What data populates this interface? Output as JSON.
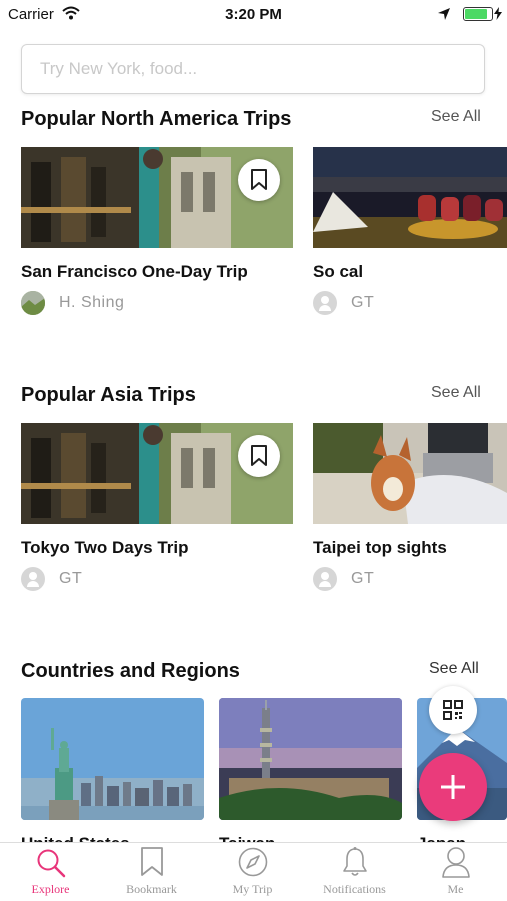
{
  "status_bar": {
    "carrier": "Carrier",
    "time": "3:20 PM"
  },
  "search": {
    "placeholder": "Try New York, food..."
  },
  "sections": {
    "north_america": {
      "title": "Popular North America Trips",
      "see_all": "See All",
      "cards": [
        {
          "title": "San Francisco One-Day Trip",
          "author": "H. Shing"
        },
        {
          "title": "So cal",
          "author": "GT"
        }
      ]
    },
    "asia": {
      "title": "Popular Asia Trips",
      "see_all": "See All",
      "cards": [
        {
          "title": "Tokyo Two Days Trip",
          "author": "GT"
        },
        {
          "title": "Taipei top sights",
          "author": "GT"
        }
      ]
    },
    "regions": {
      "title": "Countries and Regions",
      "see_all": "See All",
      "items": [
        {
          "label": "United States"
        },
        {
          "label": "Taiwan"
        },
        {
          "label": "Japan"
        }
      ]
    }
  },
  "tab_bar": {
    "tabs": [
      {
        "label": "Explore",
        "icon": "search-icon",
        "active": true
      },
      {
        "label": "Bookmark",
        "icon": "bookmark-icon",
        "active": false
      },
      {
        "label": "My Trip",
        "icon": "compass-icon",
        "active": false
      },
      {
        "label": "Notifications",
        "icon": "bell-icon",
        "active": false
      },
      {
        "label": "Me",
        "icon": "person-icon",
        "active": false
      }
    ]
  },
  "colors": {
    "accent": "#ea3b7b",
    "active_tab": "#e8357a"
  }
}
